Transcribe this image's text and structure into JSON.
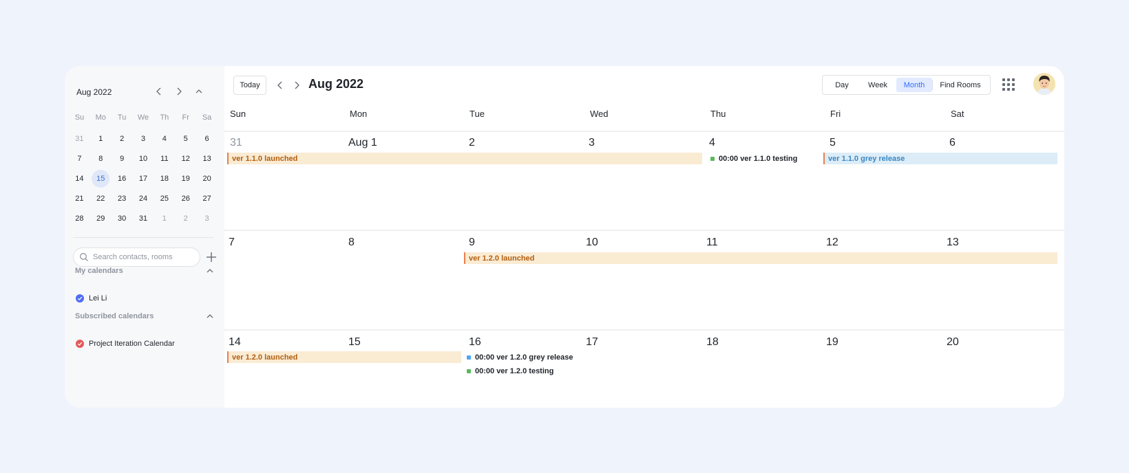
{
  "sidebar": {
    "mini_title": "Aug 2022",
    "weekdays": [
      "Su",
      "Mo",
      "Tu",
      "We",
      "Th",
      "Fr",
      "Sa"
    ],
    "weeks": [
      [
        {
          "d": "31",
          "m": true
        },
        {
          "d": "1"
        },
        {
          "d": "2"
        },
        {
          "d": "3"
        },
        {
          "d": "4"
        },
        {
          "d": "5"
        },
        {
          "d": "6"
        }
      ],
      [
        {
          "d": "7"
        },
        {
          "d": "8"
        },
        {
          "d": "9"
        },
        {
          "d": "10"
        },
        {
          "d": "11"
        },
        {
          "d": "12"
        },
        {
          "d": "13"
        }
      ],
      [
        {
          "d": "14"
        },
        {
          "d": "15",
          "sel": true
        },
        {
          "d": "16"
        },
        {
          "d": "17"
        },
        {
          "d": "18"
        },
        {
          "d": "19"
        },
        {
          "d": "20"
        }
      ],
      [
        {
          "d": "21"
        },
        {
          "d": "22"
        },
        {
          "d": "23"
        },
        {
          "d": "24"
        },
        {
          "d": "25"
        },
        {
          "d": "26"
        },
        {
          "d": "27"
        }
      ],
      [
        {
          "d": "28"
        },
        {
          "d": "29"
        },
        {
          "d": "30"
        },
        {
          "d": "31"
        },
        {
          "d": "1",
          "m": true
        },
        {
          "d": "2",
          "m": true
        },
        {
          "d": "3",
          "m": true
        }
      ]
    ],
    "search_placeholder": "Search contacts, rooms",
    "my_calendars_title": "My calendars",
    "my_calendars": [
      {
        "label": "Lei Li",
        "color": "#4e6ef2"
      }
    ],
    "subscribed_title": "Subscribed calendars",
    "subscribed": [
      {
        "label": "Project Iteration Calendar",
        "color": "#e25b5b"
      }
    ]
  },
  "header": {
    "today_label": "Today",
    "title": "Aug 2022",
    "views": [
      "Day",
      "Week",
      "Month",
      "Find Rooms"
    ],
    "active_view": "Month"
  },
  "calendar": {
    "weekdays": [
      "Sun",
      "Mon",
      "Tue",
      "Wed",
      "Thu",
      "Fri",
      "Sat"
    ],
    "weeks": [
      [
        "31",
        "Aug 1",
        "2",
        "3",
        "4",
        "5",
        "6"
      ],
      [
        "7",
        "8",
        "9",
        "10",
        "11",
        "12",
        "13"
      ],
      [
        "14",
        "15",
        "16",
        "17",
        "18",
        "19",
        "20"
      ]
    ],
    "muted_days": [
      "31"
    ],
    "events": {
      "w1_span_1": "ver 1.1.0 launched",
      "w1_dot_1": "00:00 ver 1.1.0 testing",
      "w1_span_2": "ver 1.1.0 grey release",
      "w2_span_1": "ver 1.2.0 launched",
      "w3_span_1": "ver 1.2.0 launched",
      "w3_dot_1": "00:00 ver 1.2.0 grey release",
      "w3_dot_2": "00:00 ver 1.2.0 testing"
    }
  },
  "colors": {
    "accent": "#3370ff",
    "event_orange_bg": "#faebd3",
    "event_blue_bg": "#dcedf8",
    "dot_green": "#5cb85c",
    "dot_blue": "#4ea6f5"
  }
}
